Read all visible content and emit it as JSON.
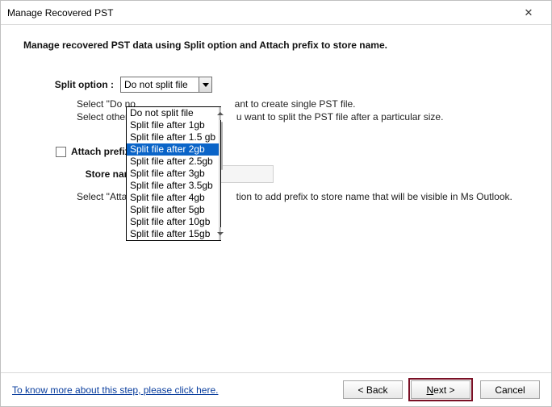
{
  "window": {
    "title": "Manage Recovered PST",
    "close_glyph": "✕"
  },
  "heading": "Manage recovered PST data using Split option and Attach prefix to store name.",
  "split": {
    "label": "Split option :",
    "selected": "Do not split file",
    "desc_line1_a": "Select \"Do no",
    "desc_line1_b": "ant to create single PST file.",
    "desc_line2_a": "Select other P",
    "desc_line2_b": "u want to split the PST file after a particular size.",
    "options": [
      "Do not split file",
      "Split file after 1gb",
      "Split file after 1.5 gb",
      "Split file after 2gb",
      "Split file after 2.5gb",
      "Split file after 3gb",
      "Split file after 3.5gb",
      "Split file after 4gb",
      "Split file after 5gb",
      "Split file after 10gb",
      "Split file after 15gb"
    ],
    "highlighted_index": 3
  },
  "prefix": {
    "checkbox_label_a": "Attach prefix t",
    "store_label": "Store name",
    "store_value": "",
    "desc_a": "Select \"Attach",
    "desc_b": "tion to add prefix to store name that will be visible in Ms Outlook."
  },
  "footer": {
    "help_link": "To know more about this step, please click here.",
    "back": "< Back",
    "next_prefix": "N",
    "next_suffix": "ext >",
    "cancel": "Cancel"
  }
}
